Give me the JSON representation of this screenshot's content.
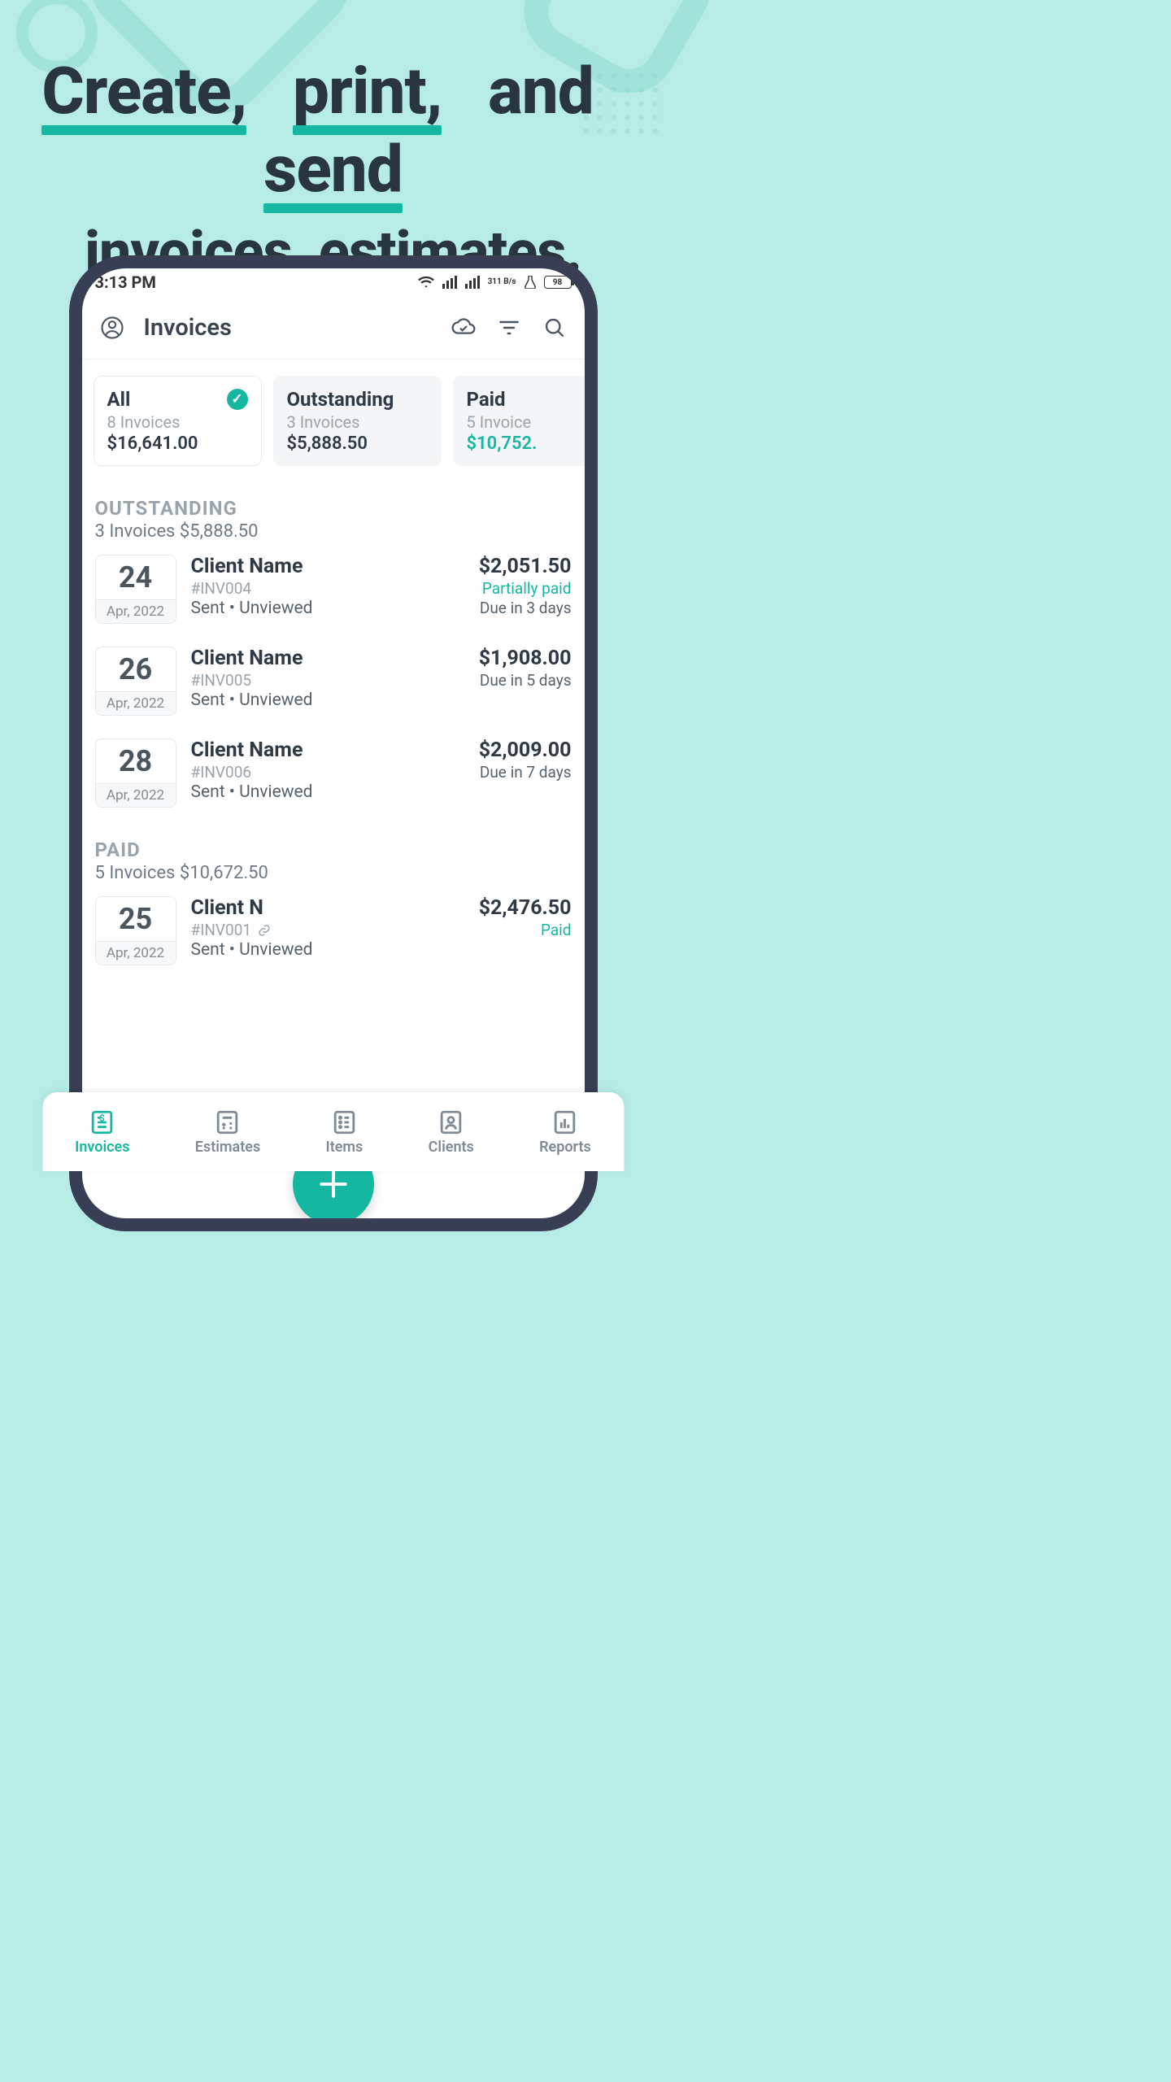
{
  "headline": {
    "w1": "Create,",
    "w2": "print,",
    "w_and": "and",
    "w3": "send",
    "line2": "invoices, estimates."
  },
  "status": {
    "time": "3:13 PM",
    "battery": "98",
    "speed": "311 B/s"
  },
  "header": {
    "title": "Invoices"
  },
  "filters": [
    {
      "title": "All",
      "sub": "8 Invoices",
      "amount": "$16,641.00",
      "active": true
    },
    {
      "title": "Outstanding",
      "sub": "3 Invoices",
      "amount": "$5,888.50",
      "active": false
    },
    {
      "title": "Paid",
      "sub": "5 Invoice",
      "amount": "$10,752.",
      "active": false,
      "green": true
    }
  ],
  "sections": {
    "outstanding": {
      "title": "OUTSTANDING",
      "sub": "3 Invoices $5,888.50"
    },
    "paid": {
      "title": "PAID",
      "sub": "5 Invoices $10,672.50"
    }
  },
  "invoices_outstanding": [
    {
      "day": "24",
      "month": "Apr, 2022",
      "client": "Client Name",
      "invno": "#INV004",
      "status": "Sent  •  Unviewed",
      "amount": "$2,051.50",
      "note": "Partially paid",
      "green": true,
      "due": "Due in 3 days"
    },
    {
      "day": "26",
      "month": "Apr, 2022",
      "client": "Client Name",
      "invno": "#INV005",
      "status": "Sent  •  Unviewed",
      "amount": "$1,908.00",
      "note": "",
      "due": "Due in 5 days"
    },
    {
      "day": "28",
      "month": "Apr, 2022",
      "client": "Client Name",
      "invno": "#INV006",
      "status": "Sent  •  Unviewed",
      "amount": "$2,009.00",
      "note": "",
      "due": "Due in 7 days"
    }
  ],
  "invoices_paid": [
    {
      "day": "25",
      "month": "Apr, 2022",
      "client": "Client N",
      "invno": "#INV001",
      "status": "Sent  •  Unviewed",
      "amount": "$2,476.50",
      "note": "Paid",
      "green": true,
      "due": ""
    }
  ],
  "tabs": [
    {
      "label": "Invoices",
      "active": true
    },
    {
      "label": "Estimates"
    },
    {
      "label": "Items"
    },
    {
      "label": "Clients"
    },
    {
      "label": "Reports"
    }
  ]
}
